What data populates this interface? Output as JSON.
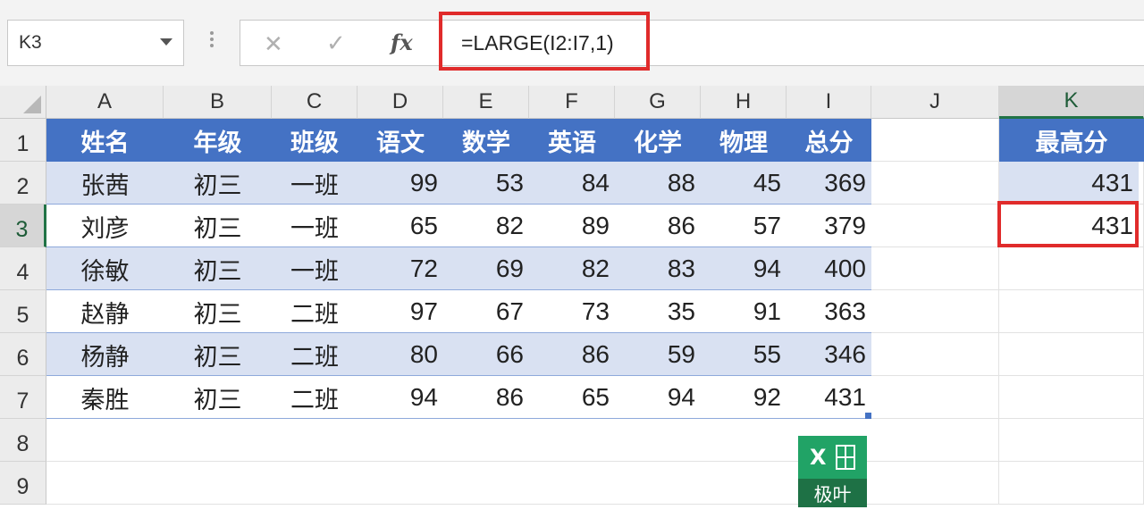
{
  "name_box": "K3",
  "formula_bar": {
    "cancel_icon": "cancel-x-icon",
    "enter_icon": "enter-check-icon",
    "fx_label": "fx",
    "formula": "=LARGE(I2:I7,1)"
  },
  "columns": [
    "A",
    "B",
    "C",
    "D",
    "E",
    "F",
    "G",
    "H",
    "I",
    "J",
    "K"
  ],
  "rows": [
    "1",
    "2",
    "3",
    "4",
    "5",
    "6",
    "7",
    "8",
    "9"
  ],
  "table": {
    "headers": [
      "姓名",
      "年级",
      "班级",
      "语文",
      "数学",
      "英语",
      "化学",
      "物理",
      "总分"
    ],
    "rows": [
      [
        "张茜",
        "初三",
        "一班",
        "99",
        "53",
        "84",
        "88",
        "45",
        "369"
      ],
      [
        "刘彦",
        "初三",
        "一班",
        "65",
        "82",
        "89",
        "86",
        "57",
        "379"
      ],
      [
        "徐敏",
        "初三",
        "一班",
        "72",
        "69",
        "82",
        "83",
        "94",
        "400"
      ],
      [
        "赵静",
        "初三",
        "二班",
        "97",
        "67",
        "73",
        "35",
        "91",
        "363"
      ],
      [
        "杨静",
        "初三",
        "二班",
        "80",
        "66",
        "86",
        "59",
        "55",
        "346"
      ],
      [
        "秦胜",
        "初三",
        "二班",
        "94",
        "86",
        "65",
        "94",
        "92",
        "431"
      ]
    ]
  },
  "side_table": {
    "header": "最高分",
    "values": [
      "431",
      "431"
    ]
  },
  "logo": {
    "mark": "X",
    "text": "极叶"
  },
  "colors": {
    "header_fill": "#4472c4",
    "band_fill": "#d9e1f2",
    "highlight": "#e02b2b",
    "excel_green": "#217346"
  }
}
